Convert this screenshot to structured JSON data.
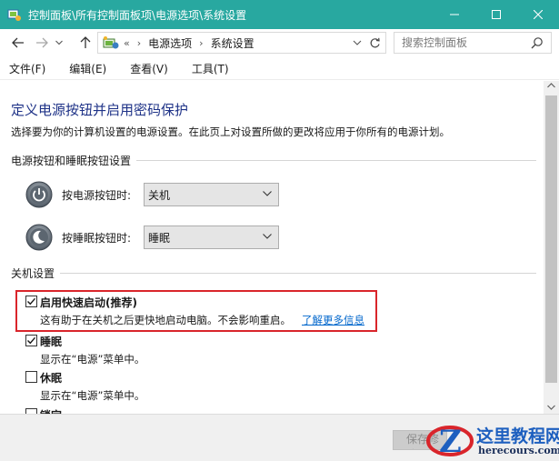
{
  "window": {
    "title": "控制面板\\所有控制面板项\\电源选项\\系统设置",
    "accent_color": "#28a8a0"
  },
  "address": {
    "overflow": "«",
    "crumbs": [
      "电源选项",
      "系统设置"
    ],
    "search_placeholder": "搜索控制面板"
  },
  "menu": {
    "items": [
      "文件(F)",
      "编辑(E)",
      "查看(V)",
      "工具(T)"
    ]
  },
  "page": {
    "title": "定义电源按钮并启用密码保护",
    "description": "选择要为你的计算机设置的电源设置。在此页上对设置所做的更改将应用于你所有的电源计划。",
    "power_group": {
      "label": "电源按钮和睡眠按钮设置",
      "rows": [
        {
          "label": "按电源按钮时:",
          "value": "关机",
          "icon": "power-icon"
        },
        {
          "label": "按睡眠按钮时:",
          "value": "睡眠",
          "icon": "sleep-icon"
        }
      ]
    },
    "shutdown_group": {
      "label": "关机设置",
      "options": [
        {
          "title": "启用快速启动(推荐)",
          "desc": "这有助于在关机之后更快地启动电脑。不会影响重启。",
          "link": "了解更多信息",
          "checked": true
        },
        {
          "title": "睡眠",
          "desc": "显示在“电源”菜单中。",
          "checked": true
        },
        {
          "title": "休眠",
          "desc": "显示在“电源”菜单中。",
          "checked": false
        },
        {
          "title": "锁定",
          "desc": "",
          "checked": false
        }
      ]
    }
  },
  "footer": {
    "save_label": "保存修改"
  },
  "watermark": {
    "brand": "这里教程网",
    "url": "herecours.com"
  }
}
